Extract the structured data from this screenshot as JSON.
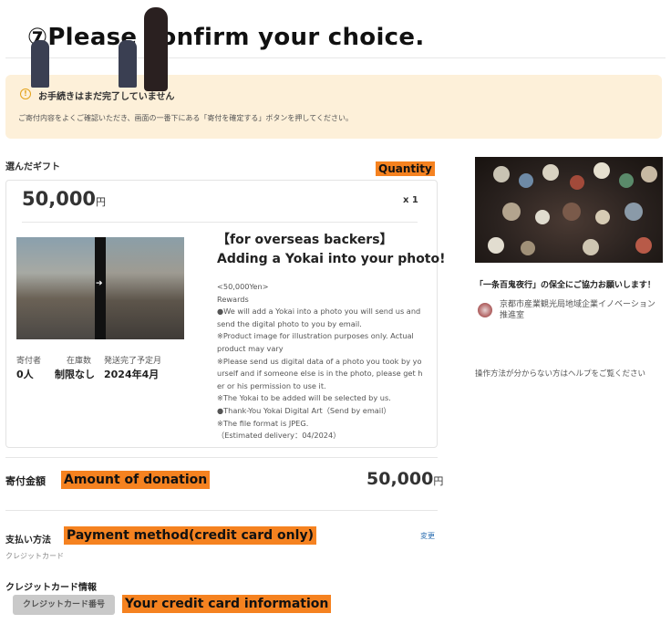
{
  "header": {
    "step_title": "⑦Please confirm your choice."
  },
  "notice": {
    "icon": "info-icon",
    "title": "お手続きはまだ完了していません",
    "body": "ご寄付内容をよくご確認いただき、画面の一番下にある「寄付を確定する」ボタンを押してください。"
  },
  "annotations": {
    "quantity": "Quantity",
    "amount": "Amount of donation",
    "payment": "Payment method(credit card only)",
    "card_info": "Your credit card information",
    "color": "#f58220"
  },
  "gift": {
    "section_label": "選んだギフト",
    "price": "50,000",
    "yen": "円",
    "quantity": "x 1",
    "title_lines": [
      "【for overseas backers】",
      "Adding a Yokai into your photo!"
    ],
    "description_lines": [
      "<50,000Yen>",
      "Rewards",
      "●We will add a Yokai into a photo you will send us and",
      "send the digital photo to you by email.",
      "※Product image for illustration purposes only. Actual",
      "product may vary",
      "※Please send us digital data of a photo you took by yo",
      "urself and if someone else is in the photo, please get h",
      "er or his permission to use it.",
      "※The Yokai to be added will be selected by us.",
      "●Thank-You Yokai Digital Art（Send by email）",
      "※The file format is JPEG.",
      "（Estimated delivery：04/2024）"
    ],
    "stats": {
      "donors_label": "寄付者",
      "donors_value": "0人",
      "stock_label": "在庫数",
      "stock_value": "制限なし",
      "delivery_label": "発送完了予定月",
      "delivery_value": "2024年4月"
    }
  },
  "amount": {
    "label": "寄付金額",
    "value": "50,000",
    "yen": "円"
  },
  "payment": {
    "label": "支払い方法",
    "method": "クレジットカード",
    "change": "変更"
  },
  "credit_card": {
    "label": "クレジットカード情報",
    "button": "クレジットカード番号"
  },
  "sidebar": {
    "project_title": "「一条百鬼夜行」の保全にご協力お願いします！",
    "org_lines": [
      "京都市産業観光局地域企業イノベーション",
      "推進室"
    ],
    "help": "操作方法が分からない方はヘルプをご覧ください"
  }
}
